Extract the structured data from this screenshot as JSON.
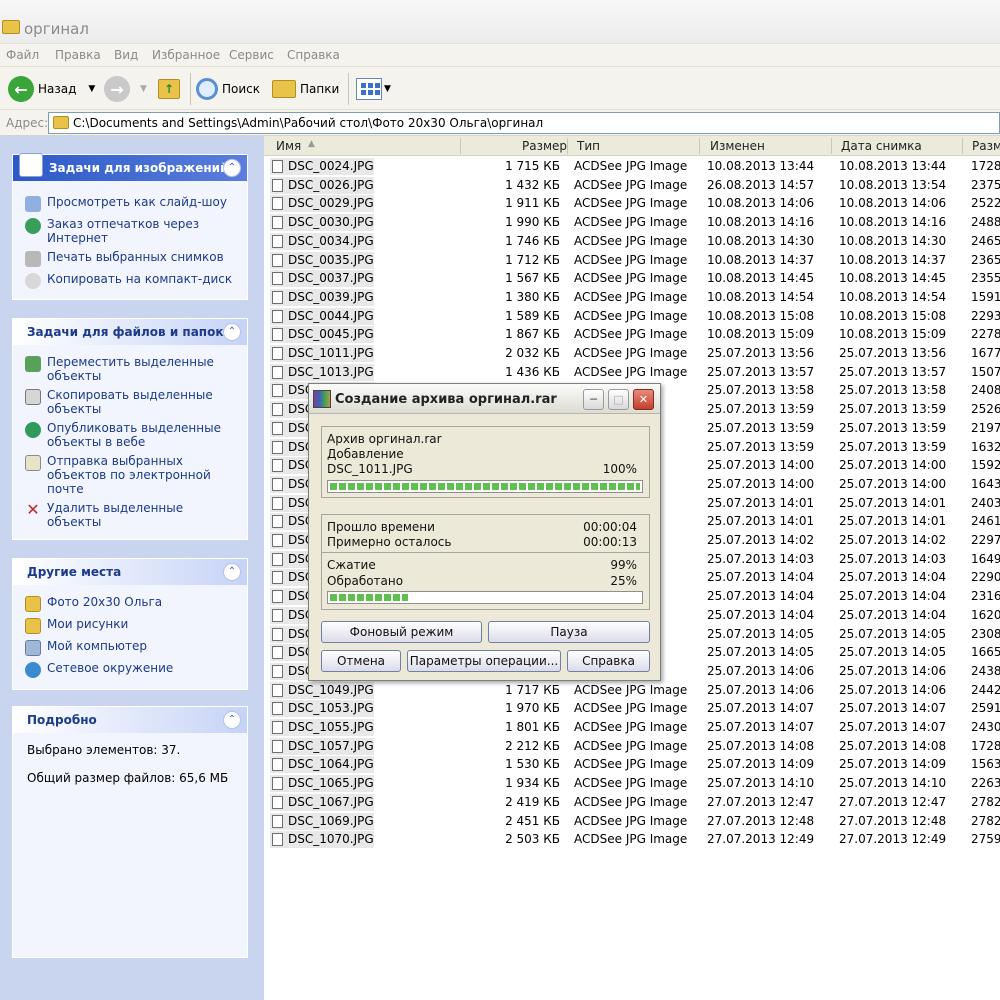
{
  "window": {
    "title": "оргинал"
  },
  "menu": [
    "Файл",
    "Правка",
    "Вид",
    "Избранное",
    "Сервис",
    "Справка"
  ],
  "toolbar": {
    "back": "Назад",
    "search": "Поиск",
    "folders": "Папки"
  },
  "address": {
    "label": "Адрес:",
    "path": "C:\\Documents and Settings\\Admin\\Рабочий стол\\Фото 20x30 Ольга\\оргинал"
  },
  "left": {
    "image_tasks": {
      "title": "Задачи для изображений",
      "items": [
        "Просмотреть как слайд-шоу",
        "Заказ отпечатков через Интернет",
        "Печать выбранных снимков",
        "Копировать на компакт-диск"
      ]
    },
    "file_tasks": {
      "title": "Задачи для файлов и папок",
      "items": [
        "Переместить выделенные объекты",
        "Скопировать выделенные объекты",
        "Опубликовать выделенные объекты в вебе",
        "Отправка выбранных объектов по электронной почте",
        "Удалить выделенные объекты"
      ]
    },
    "other_places": {
      "title": "Другие места",
      "items": [
        "Фото 20x30 Ольга",
        "Мои рисунки",
        "Мой компьютер",
        "Сетевое окружение"
      ]
    },
    "details": {
      "title": "Подробно",
      "selected": "Выбрано элементов: 37.",
      "total": "Общий размер файлов: 65,6 МБ"
    }
  },
  "columns": {
    "name": "Имя",
    "size": "Размер",
    "type": "Тип",
    "modified": "Изменен",
    "taken": "Дата снимка",
    "dims": "Разме"
  },
  "files": [
    {
      "name": "DSC_0024.JPG",
      "size": "1 715 КБ",
      "type": "ACDSee JPG Image",
      "mod": "10.08.2013 13:44",
      "taken": "10.08.2013 13:44",
      "dim": "1728"
    },
    {
      "name": "DSC_0026.JPG",
      "size": "1 432 КБ",
      "type": "ACDSee JPG Image",
      "mod": "26.08.2013 14:57",
      "taken": "10.08.2013 13:54",
      "dim": "2375"
    },
    {
      "name": "DSC_0029.JPG",
      "size": "1 911 КБ",
      "type": "ACDSee JPG Image",
      "mod": "10.08.2013 14:06",
      "taken": "10.08.2013 14:06",
      "dim": "2522"
    },
    {
      "name": "DSC_0030.JPG",
      "size": "1 990 КБ",
      "type": "ACDSee JPG Image",
      "mod": "10.08.2013 14:16",
      "taken": "10.08.2013 14:16",
      "dim": "2488"
    },
    {
      "name": "DSC_0034.JPG",
      "size": "1 746 КБ",
      "type": "ACDSee JPG Image",
      "mod": "10.08.2013 14:30",
      "taken": "10.08.2013 14:30",
      "dim": "2465"
    },
    {
      "name": "DSC_0035.JPG",
      "size": "1 712 КБ",
      "type": "ACDSee JPG Image",
      "mod": "10.08.2013 14:37",
      "taken": "10.08.2013 14:37",
      "dim": "2365"
    },
    {
      "name": "DSC_0037.JPG",
      "size": "1 567 КБ",
      "type": "ACDSee JPG Image",
      "mod": "10.08.2013 14:45",
      "taken": "10.08.2013 14:45",
      "dim": "2355"
    },
    {
      "name": "DSC_0039.JPG",
      "size": "1 380 КБ",
      "type": "ACDSee JPG Image",
      "mod": "10.08.2013 14:54",
      "taken": "10.08.2013 14:54",
      "dim": "1591"
    },
    {
      "name": "DSC_0044.JPG",
      "size": "1 589 КБ",
      "type": "ACDSee JPG Image",
      "mod": "10.08.2013 15:08",
      "taken": "10.08.2013 15:08",
      "dim": "2293"
    },
    {
      "name": "DSC_0045.JPG",
      "size": "1 867 КБ",
      "type": "ACDSee JPG Image",
      "mod": "10.08.2013 15:09",
      "taken": "10.08.2013 15:09",
      "dim": "2278"
    },
    {
      "name": "DSC_1011.JPG",
      "size": "2 032 КБ",
      "type": "ACDSee JPG Image",
      "mod": "25.07.2013 13:56",
      "taken": "25.07.2013 13:56",
      "dim": "1677"
    },
    {
      "name": "DSC_1013.JPG",
      "size": "1 436 КБ",
      "type": "ACDSee JPG Image",
      "mod": "25.07.2013 13:57",
      "taken": "25.07.2013 13:57",
      "dim": "1507"
    },
    {
      "name": "DSC_",
      "size": "",
      "type": "ge",
      "mod": "25.07.2013 13:58",
      "taken": "25.07.2013 13:58",
      "dim": "2408"
    },
    {
      "name": "DSC_",
      "size": "",
      "type": "ge",
      "mod": "25.07.2013 13:59",
      "taken": "25.07.2013 13:59",
      "dim": "2526"
    },
    {
      "name": "DSC_",
      "size": "",
      "type": "ge",
      "mod": "25.07.2013 13:59",
      "taken": "25.07.2013 13:59",
      "dim": "2197"
    },
    {
      "name": "DSC_",
      "size": "",
      "type": "ge",
      "mod": "25.07.2013 13:59",
      "taken": "25.07.2013 13:59",
      "dim": "1632"
    },
    {
      "name": "DSC_",
      "size": "",
      "type": "ge",
      "mod": "25.07.2013 14:00",
      "taken": "25.07.2013 14:00",
      "dim": "1592"
    },
    {
      "name": "DSC_",
      "size": "",
      "type": "ge",
      "mod": "25.07.2013 14:00",
      "taken": "25.07.2013 14:00",
      "dim": "1643"
    },
    {
      "name": "DSC_",
      "size": "",
      "type": "ge",
      "mod": "25.07.2013 14:01",
      "taken": "25.07.2013 14:01",
      "dim": "2403"
    },
    {
      "name": "DSC_",
      "size": "",
      "type": "ge",
      "mod": "25.07.2013 14:01",
      "taken": "25.07.2013 14:01",
      "dim": "2461"
    },
    {
      "name": "DSC_",
      "size": "",
      "type": "ge",
      "mod": "25.07.2013 14:02",
      "taken": "25.07.2013 14:02",
      "dim": "2297"
    },
    {
      "name": "DSC_",
      "size": "",
      "type": "ge",
      "mod": "25.07.2013 14:03",
      "taken": "25.07.2013 14:03",
      "dim": "1649"
    },
    {
      "name": "DSC_",
      "size": "",
      "type": "ge",
      "mod": "25.07.2013 14:04",
      "taken": "25.07.2013 14:04",
      "dim": "2290"
    },
    {
      "name": "DSC_",
      "size": "",
      "type": "ge",
      "mod": "25.07.2013 14:04",
      "taken": "25.07.2013 14:04",
      "dim": "2316"
    },
    {
      "name": "DSC_",
      "size": "",
      "type": "ge",
      "mod": "25.07.2013 14:04",
      "taken": "25.07.2013 14:04",
      "dim": "1620"
    },
    {
      "name": "DSC_",
      "size": "",
      "type": "ge",
      "mod": "25.07.2013 14:05",
      "taken": "25.07.2013 14:05",
      "dim": "2308"
    },
    {
      "name": "DSC_",
      "size": "",
      "type": "ge",
      "mod": "25.07.2013 14:05",
      "taken": "25.07.2013 14:05",
      "dim": "1665"
    },
    {
      "name": "DSC_",
      "size": "",
      "type": "ge",
      "mod": "25.07.2013 14:06",
      "taken": "25.07.2013 14:06",
      "dim": "2438"
    },
    {
      "name": "DSC_1049.JPG",
      "size": "1 717 КБ",
      "type": "ACDSee JPG Image",
      "mod": "25.07.2013 14:06",
      "taken": "25.07.2013 14:06",
      "dim": "2442"
    },
    {
      "name": "DSC_1053.JPG",
      "size": "1 970 КБ",
      "type": "ACDSee JPG Image",
      "mod": "25.07.2013 14:07",
      "taken": "25.07.2013 14:07",
      "dim": "2591"
    },
    {
      "name": "DSC_1055.JPG",
      "size": "1 801 КБ",
      "type": "ACDSee JPG Image",
      "mod": "25.07.2013 14:07",
      "taken": "25.07.2013 14:07",
      "dim": "2430"
    },
    {
      "name": "DSC_1057.JPG",
      "size": "2 212 КБ",
      "type": "ACDSee JPG Image",
      "mod": "25.07.2013 14:08",
      "taken": "25.07.2013 14:08",
      "dim": "1728"
    },
    {
      "name": "DSC_1064.JPG",
      "size": "1 530 КБ",
      "type": "ACDSee JPG Image",
      "mod": "25.07.2013 14:09",
      "taken": "25.07.2013 14:09",
      "dim": "1563"
    },
    {
      "name": "DSC_1065.JPG",
      "size": "1 934 КБ",
      "type": "ACDSee JPG Image",
      "mod": "25.07.2013 14:10",
      "taken": "25.07.2013 14:10",
      "dim": "2263"
    },
    {
      "name": "DSC_1067.JPG",
      "size": "2 419 КБ",
      "type": "ACDSee JPG Image",
      "mod": "27.07.2013 12:47",
      "taken": "27.07.2013 12:47",
      "dim": "2782"
    },
    {
      "name": "DSC_1069.JPG",
      "size": "2 451 КБ",
      "type": "ACDSee JPG Image",
      "mod": "27.07.2013 12:48",
      "taken": "27.07.2013 12:48",
      "dim": "2782"
    },
    {
      "name": "DSC_1070.JPG",
      "size": "2 503 КБ",
      "type": "ACDSee JPG Image",
      "mod": "27.07.2013 12:49",
      "taken": "27.07.2013 12:49",
      "dim": "2759"
    }
  ],
  "dialog": {
    "title": "Создание архива оргинал.rar",
    "archive": "Архив оргинал.rar",
    "action": "Добавление",
    "current_file": "DSC_1011.JPG",
    "file_percent": "100%",
    "file_progress": 1.0,
    "elapsed_label": "Прошло времени",
    "elapsed": "00:00:04",
    "remaining_label": "Примерно осталось",
    "remaining": "00:00:13",
    "compression_label": "Сжатие",
    "compression": "99%",
    "processed_label": "Обработано",
    "processed": "25%",
    "total_progress": 0.25,
    "btn_background": "Фоновый режим",
    "btn_pause": "Пауза",
    "btn_cancel": "Отмена",
    "btn_params": "Параметры операции...",
    "btn_help": "Справка"
  }
}
